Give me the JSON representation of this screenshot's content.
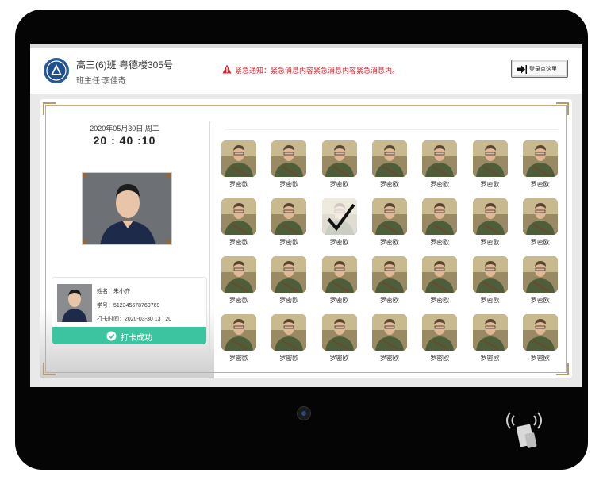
{
  "header": {
    "class_name": "高三(6)班 粤德楼305号",
    "teacher": "班主任:李佳奇",
    "notice_text": "紧急通知：紧急消息内容紧急消息内容紧急消息内。",
    "login_label": "登录点这里"
  },
  "clock": {
    "date": "2020年05月30日 周二",
    "time": "20 : 40 :10"
  },
  "checkin": {
    "name": "姓名：朱小齐",
    "student_id": "学号：512345678769769",
    "time": "打卡时间：2020-03-30    13 : 20",
    "status": "打卡成功"
  },
  "students": [
    {
      "name": "罗密欧",
      "checked": false
    },
    {
      "name": "罗密欧",
      "checked": false
    },
    {
      "name": "罗密欧",
      "checked": false
    },
    {
      "name": "罗密欧",
      "checked": false
    },
    {
      "name": "罗密欧",
      "checked": false
    },
    {
      "name": "罗密欧",
      "checked": false
    },
    {
      "name": "罗密欧",
      "checked": false
    },
    {
      "name": "罗密欧",
      "checked": false
    },
    {
      "name": "罗密欧",
      "checked": false
    },
    {
      "name": "罗密欧",
      "checked": true
    },
    {
      "name": "罗密欧",
      "checked": false
    },
    {
      "name": "罗密欧",
      "checked": false
    },
    {
      "name": "罗密欧",
      "checked": false
    },
    {
      "name": "罗密欧",
      "checked": false
    },
    {
      "name": "罗密欧",
      "checked": false
    },
    {
      "name": "罗密欧",
      "checked": false
    },
    {
      "name": "罗密欧",
      "checked": false
    },
    {
      "name": "罗密欧",
      "checked": false
    },
    {
      "name": "罗密欧",
      "checked": false
    },
    {
      "name": "罗密欧",
      "checked": false
    },
    {
      "name": "罗密欧",
      "checked": false
    },
    {
      "name": "罗密欧",
      "checked": false
    },
    {
      "name": "罗密欧",
      "checked": false
    },
    {
      "name": "罗密欧",
      "checked": false
    },
    {
      "name": "罗密欧",
      "checked": false
    },
    {
      "name": "罗密欧",
      "checked": false
    },
    {
      "name": "罗密欧",
      "checked": false
    },
    {
      "name": "罗密欧",
      "checked": false
    }
  ],
  "colors": {
    "accent_green": "#3cc3a0",
    "alert_red": "#d7262f",
    "frame_gold": "#c9ae83",
    "device_black": "#050505"
  },
  "icons": [
    "school-logo-icon",
    "warning-icon",
    "login-arrow-icon",
    "check-circle-icon",
    "checkmark-icon",
    "camera-icon",
    "nfc-icon"
  ]
}
